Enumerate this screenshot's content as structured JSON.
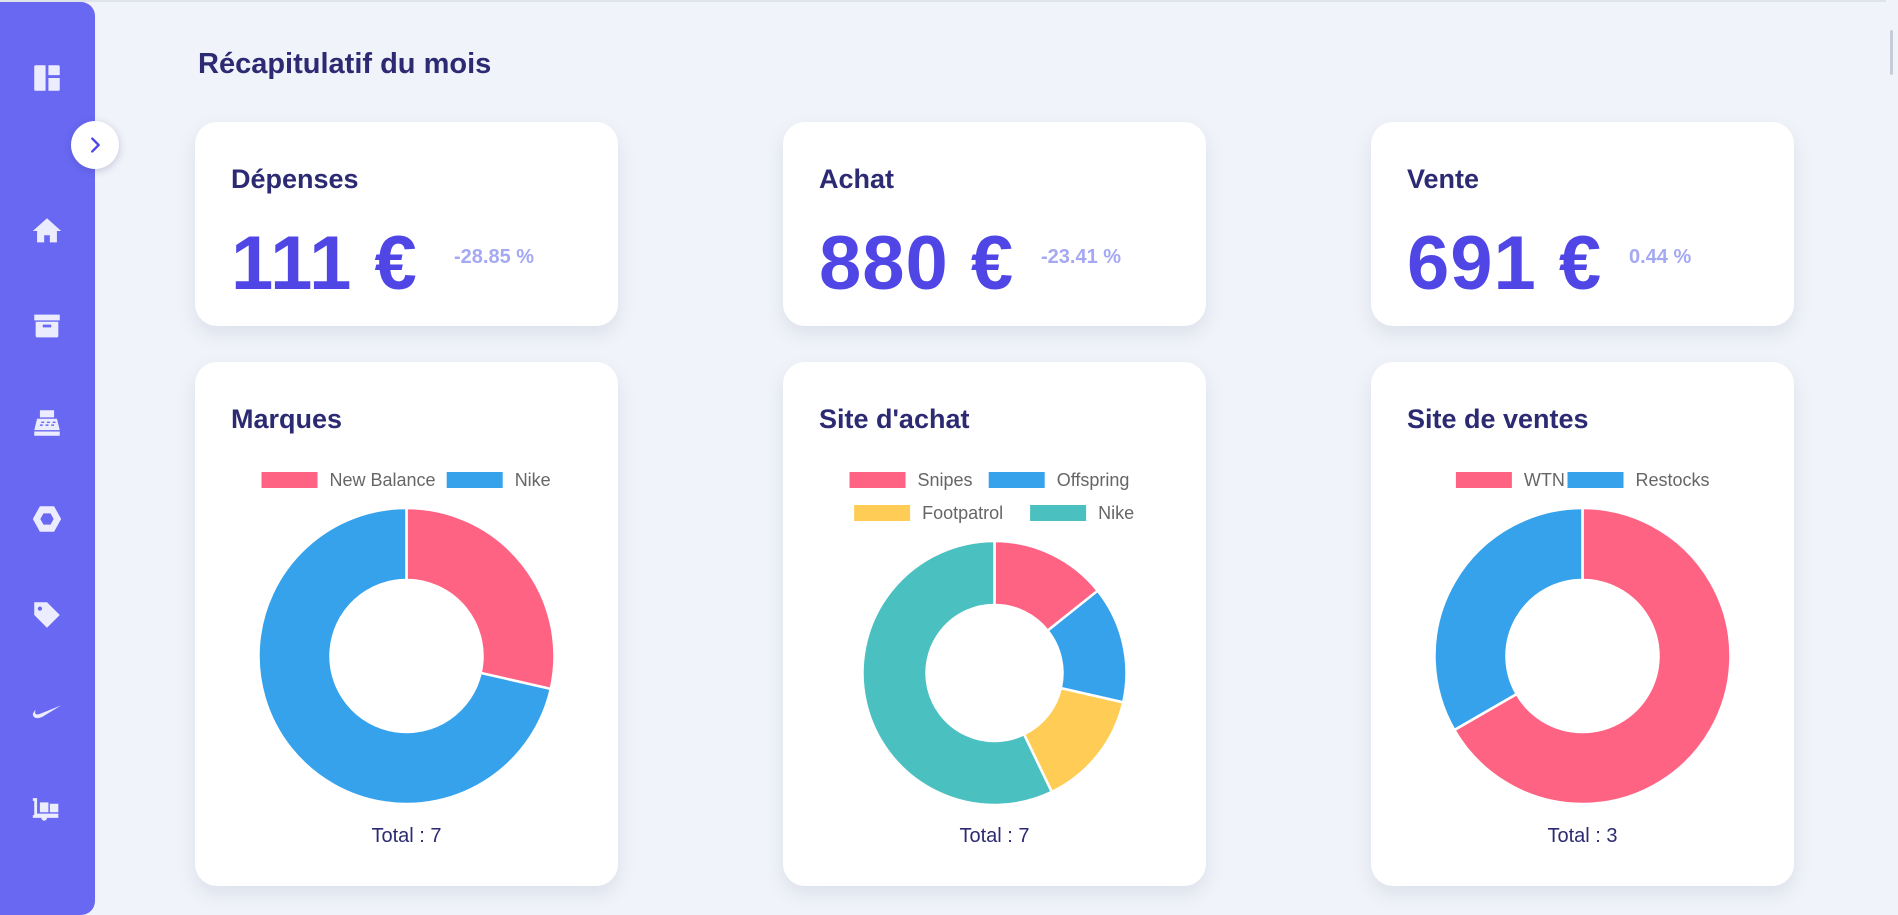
{
  "page_title": "Récapitulatif du mois",
  "sidebar": {
    "items": [
      {
        "icon": "dashboard-icon"
      },
      {
        "icon": "home-icon"
      },
      {
        "icon": "archive-icon"
      },
      {
        "icon": "cash-register-icon"
      },
      {
        "icon": "hexagon-icon"
      },
      {
        "icon": "tag-icon"
      },
      {
        "icon": "nike-swoosh-icon"
      },
      {
        "icon": "hand-truck-icon"
      }
    ],
    "toggle_icon": "chevron-right-icon",
    "color": "#6868f2"
  },
  "stats": [
    {
      "title": "Dépenses",
      "value": "111 €",
      "delta": "-28.85 %"
    },
    {
      "title": "Achat",
      "value": "880 €",
      "delta": "-23.41 %"
    },
    {
      "title": "Vente",
      "value": "691 €",
      "delta": "0.44 %"
    }
  ],
  "charts": [
    {
      "title": "Marques",
      "total_label": "Total : 7"
    },
    {
      "title": "Site d'achat",
      "total_label": "Total : 7"
    },
    {
      "title": "Site de ventes",
      "total_label": "Total : 3"
    }
  ],
  "chart_data": [
    {
      "type": "pie",
      "donut": true,
      "title": "Marques",
      "categories": [
        "New Balance",
        "Nike"
      ],
      "values": [
        2,
        5
      ],
      "colors": [
        "#ff6384",
        "#36a2eb"
      ],
      "legend": "top"
    },
    {
      "type": "pie",
      "donut": true,
      "title": "Site d'achat",
      "categories": [
        "Snipes",
        "Offspring",
        "Footpatrol",
        "Nike"
      ],
      "values": [
        1,
        1,
        1,
        4
      ],
      "colors": [
        "#ff6384",
        "#36a2eb",
        "#ffcd56",
        "#4bc0c0"
      ],
      "legend": "top"
    },
    {
      "type": "pie",
      "donut": true,
      "title": "Site de ventes",
      "categories": [
        "WTN",
        "Restocks"
      ],
      "values": [
        2,
        1
      ],
      "colors": [
        "#ff6384",
        "#36a2eb"
      ],
      "legend": "top"
    }
  ]
}
